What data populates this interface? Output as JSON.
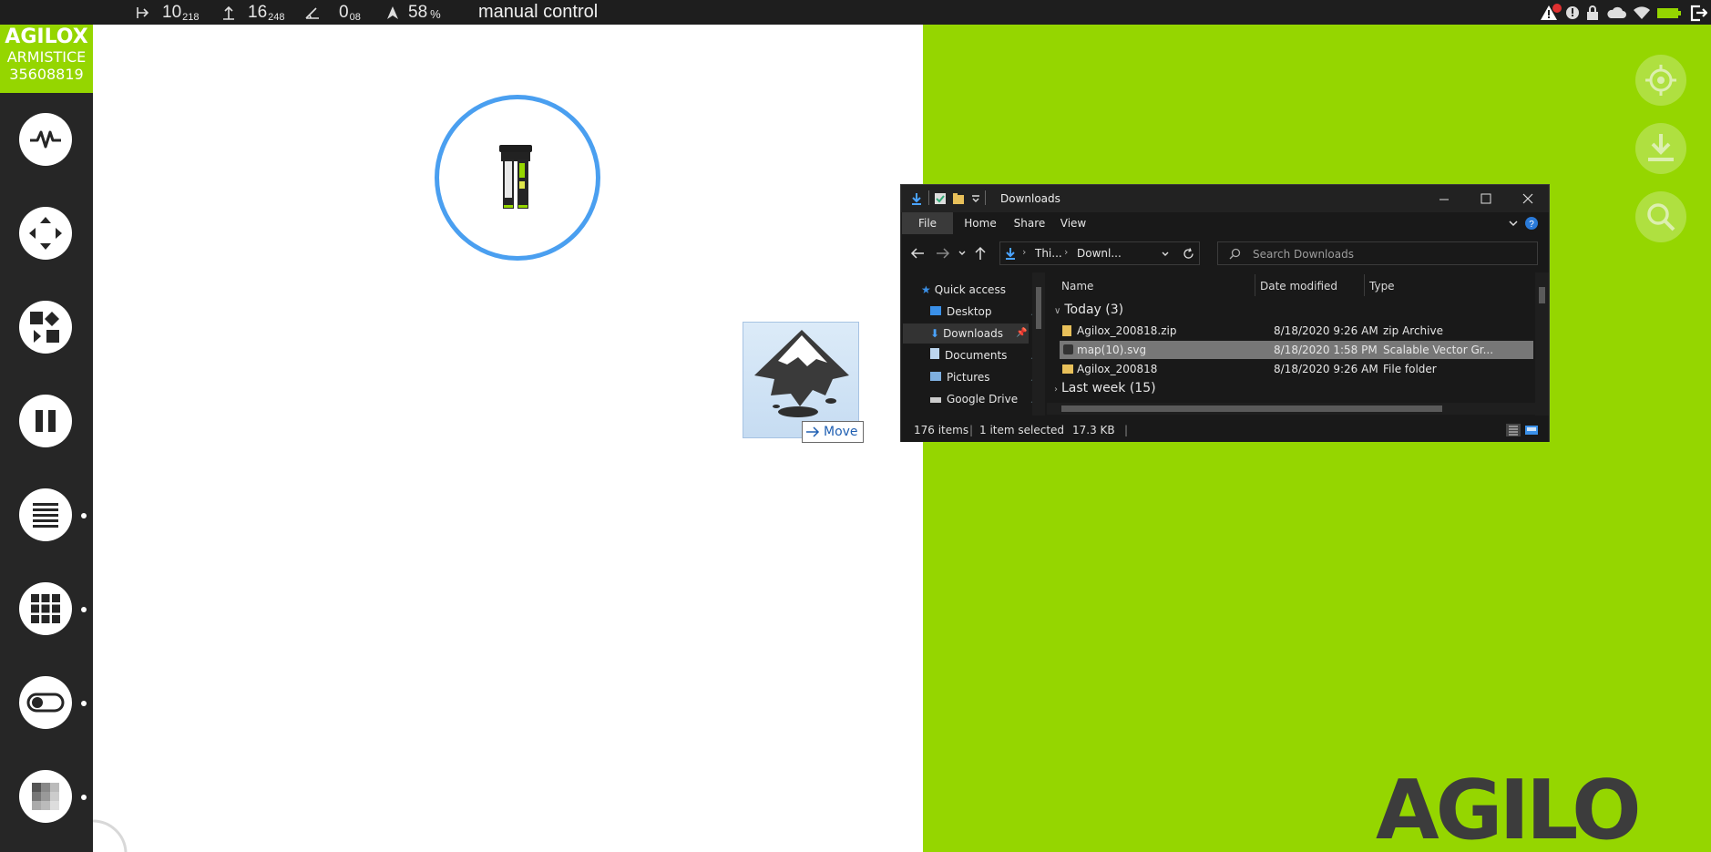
{
  "topbar": {
    "x_value": "10",
    "x_sub": "218",
    "y_value": "16",
    "y_sub": "248",
    "angle_value": "0",
    "angle_sub": "08",
    "battery_value": "58",
    "battery_unit": "%",
    "status": "manual control"
  },
  "brand": {
    "logo": "AGILOX",
    "name": "ARMISTICE",
    "serial": "35608819",
    "color": "#95d600"
  },
  "sidebar": {
    "buttons": [
      "pulse-icon",
      "move-arrows-icon",
      "route-icon",
      "pause-icon",
      "list-icon",
      "grid-icon",
      "toggle-icon",
      "heatmap-icon"
    ]
  },
  "map": {
    "drag_tooltip": "Move"
  },
  "right_buttons": [
    "locate-icon",
    "download-icon",
    "search-icon"
  ],
  "footer_logo": "AGILO",
  "explorer": {
    "title": "Downloads",
    "ribbon_tabs": [
      "File",
      "Home",
      "Share",
      "View"
    ],
    "breadcrumb": [
      "Thi...",
      "Downl..."
    ],
    "search_placeholder": "Search Downloads",
    "nav_items": [
      "Quick access",
      "Desktop",
      "Downloads",
      "Documents",
      "Pictures",
      "Google Drive"
    ],
    "columns": [
      "Name",
      "Date modified",
      "Type"
    ],
    "group_today": "Today (3)",
    "group_last_week": "Last week (15)",
    "files": [
      {
        "name": "Agilox_200818.zip",
        "date": "8/18/2020 9:26 AM",
        "type": "zip Archive"
      },
      {
        "name": "map(10).svg",
        "date": "8/18/2020 1:58 PM",
        "type": "Scalable Vector Gr..."
      },
      {
        "name": "Agilox_200818",
        "date": "8/18/2020 9:26 AM",
        "type": "File folder"
      }
    ],
    "status_items": "176 items",
    "status_selected": "1 item selected",
    "status_size": "17.3 KB"
  }
}
